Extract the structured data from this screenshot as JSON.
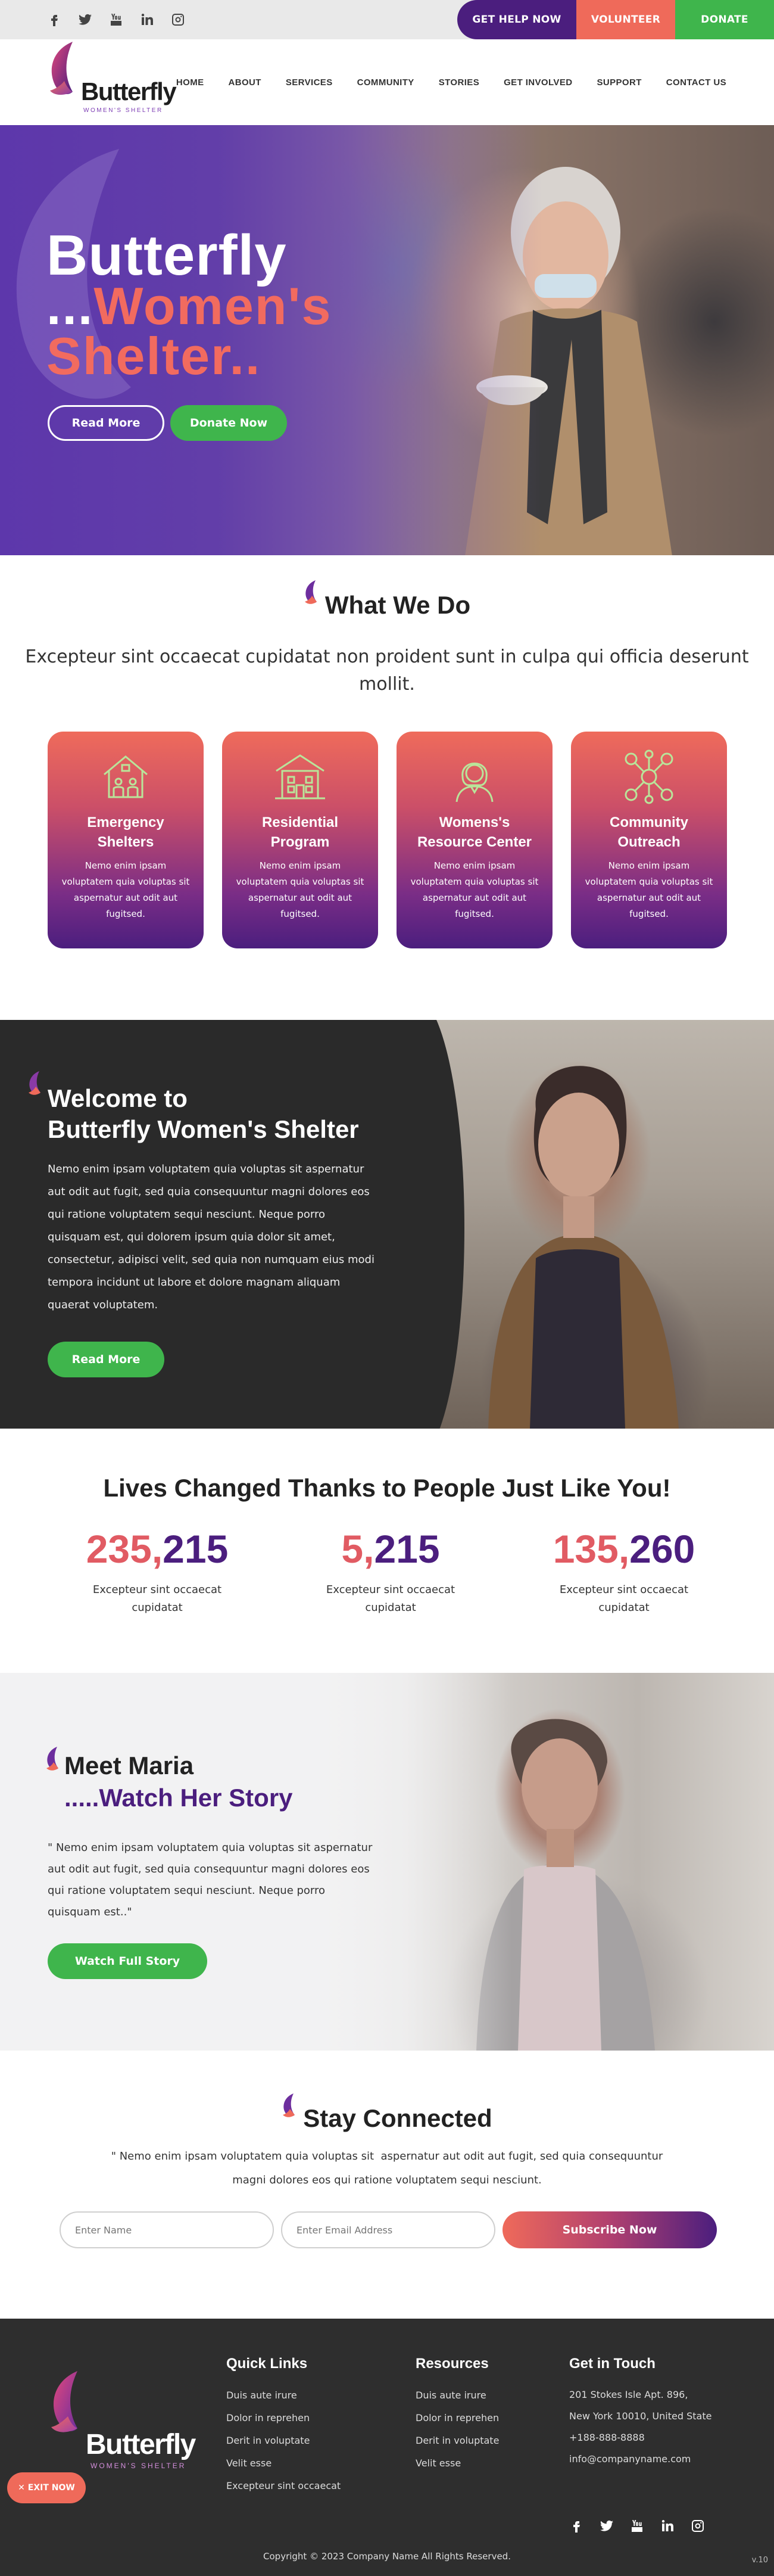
{
  "topbar": {
    "social": [
      "facebook-icon",
      "twitter-icon",
      "youtube-icon",
      "linkedin-icon",
      "instagram-icon"
    ],
    "help_label": "GET HELP NOW",
    "volunteer_label": "VOLUNTEER",
    "donate_label": "DONATE"
  },
  "header": {
    "logo_word": "Butterfly",
    "logo_sub": "WOMEN'S SHELTER",
    "nav": [
      "HOME",
      "ABOUT",
      "SERVICES",
      "COMMUNITY",
      "STORIES",
      "GET INVOLVED",
      "SUPPORT",
      "CONTACT US"
    ]
  },
  "hero": {
    "line1": "Butterfly",
    "line2_dots": "...",
    "line2": "Women's",
    "line3": "Shelter",
    "line3_dots": "..",
    "read_more": "Read More",
    "donate_now": "Donate Now"
  },
  "what_we_do": {
    "title": "What We Do",
    "lead": "Excepteur sint occaecat cupidatat non proident sunt in culpa qui officia deserunt mollit.",
    "cards": [
      {
        "icon": "house-family-icon",
        "title_1": "Emergency",
        "title_2": "Shelters",
        "text": "Nemo enim ipsam voluptatem quia voluptas sit  aspernatur aut odit aut fugitsed."
      },
      {
        "icon": "building-icon",
        "title_1": "Residential",
        "title_2": "Program",
        "text": "Nemo enim ipsam voluptatem quia voluptas sit  aspernatur aut odit aut fugitsed."
      },
      {
        "icon": "woman-icon",
        "title_1": "Womens's",
        "title_2": "Resource Center",
        "text": "Nemo enim ipsam voluptatem quia voluptas sit  aspernatur aut odit aut fugitsed."
      },
      {
        "icon": "community-network-icon",
        "title_1": "Community",
        "title_2": "Outreach",
        "text": "Nemo enim ipsam voluptatem quia voluptas sit  aspernatur aut odit aut fugitsed."
      }
    ]
  },
  "welcome": {
    "title_1": "Welcome to",
    "title_2": "Butterfly Women's Shelter",
    "body": "Nemo enim ipsam voluptatem quia voluptas sit aspernatur aut odit aut fugit, sed quia consequuntur magni dolores eos qui ratione voluptatem sequi nesciunt. Neque porro quisquam est, qui dolorem ipsum quia dolor sit amet, consectetur, adipisci velit, sed quia non numquam eius modi tempora incidunt ut labore et dolore magnam aliquam quaerat voluptatem.",
    "read_more": "Read More"
  },
  "lives": {
    "title": "Lives Changed Thanks to People Just Like You!",
    "stats": [
      {
        "head": "235,",
        "tail": "215",
        "label": "Excepteur sint occaecat cupidatat"
      },
      {
        "head": "5,",
        "tail": "215",
        "label": "Excepteur sint occaecat cupidatat"
      },
      {
        "head": "135,",
        "tail": "260",
        "label": "Excepteur sint occaecat cupidatat"
      }
    ]
  },
  "maria": {
    "title": "Meet Maria",
    "subtitle": ".....Watch Her Story",
    "quote": "\" Nemo enim ipsam voluptatem quia voluptas sit aspernatur aut odit aut fugit, sed quia consequuntur magni dolores eos qui ratione voluptatem sequi nesciunt. Neque porro quisquam est..\"",
    "button": "Watch Full Story"
  },
  "stay": {
    "title": "Stay Connected",
    "lead": "\" Nemo enim ipsam voluptatem quia voluptas sit  aspernatur aut odit aut fugit, sed quia consequuntur magni dolores eos qui ratione voluptatem sequi nesciunt.",
    "name_placeholder": "Enter Name",
    "email_placeholder": "Enter Email Address",
    "subscribe": "Subscribe Now"
  },
  "footer": {
    "logo_word": "Butterfly",
    "logo_sub": "WOMEN'S SHELTER",
    "quick_title": "Quick Links",
    "quick_links": [
      "Duis aute irure",
      "Dolor in reprehen",
      "Derit in voluptate",
      "Velit esse",
      "Excepteur sint occaecat"
    ],
    "resources_title": "Resources",
    "resources": [
      "Duis aute irure",
      "Dolor in reprehen",
      "Derit in voluptate",
      "Velit esse"
    ],
    "contact_title": "Get in Touch",
    "address_1": "201 Stokes Isle Apt. 896,",
    "address_2": "New York 10010, United State",
    "phone": "+188-888-8888",
    "email": "info@companyname.com",
    "copyright": "Copyright © 2023 Company Name All Rights Reserved.",
    "exit": "✕ EXIT NOW",
    "version": "v.10"
  },
  "colors": {
    "purple": "#4b1e7e",
    "coral": "#ef6a5a",
    "green": "#3fb54c",
    "dark": "#2a2a2a"
  }
}
